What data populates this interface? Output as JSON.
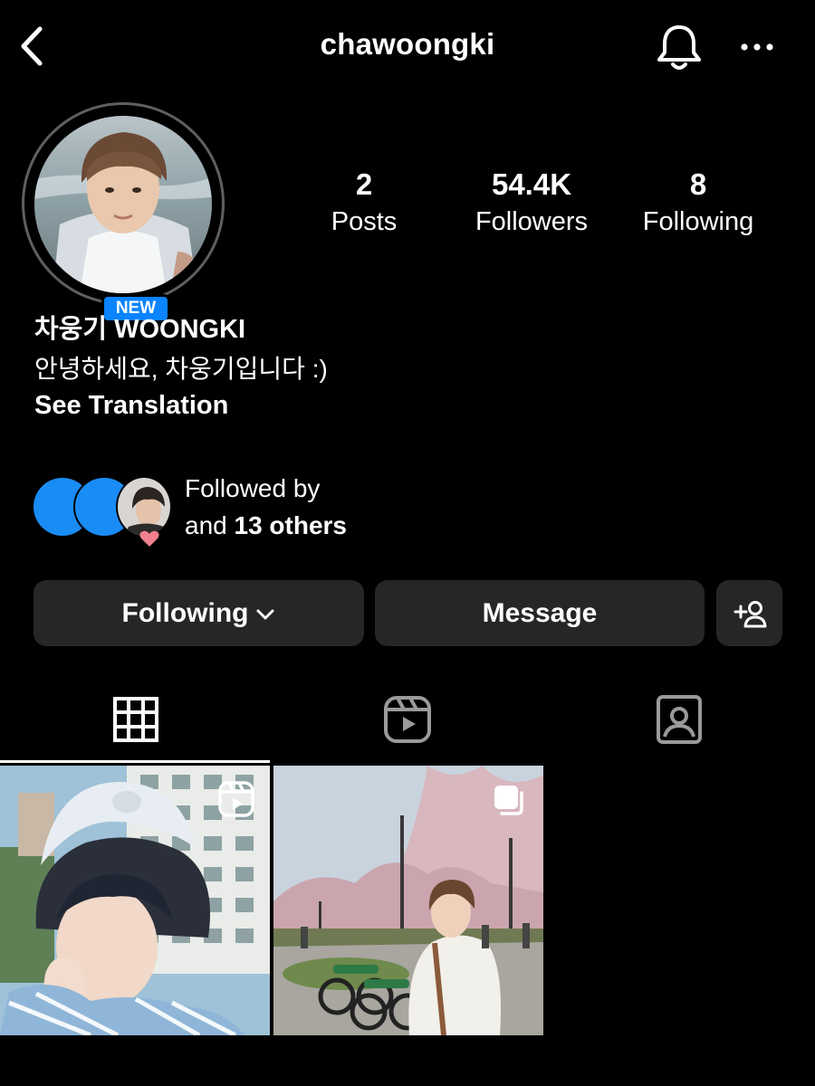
{
  "header": {
    "username": "chawoongki",
    "back_icon": "chevron-left-icon",
    "bell_icon": "bell-icon",
    "more_icon": "ellipsis-icon"
  },
  "profile": {
    "new_badge": "NEW",
    "display_name": "차웅기 WOONGKI",
    "bio": "안녕하세요, 차웅기입니다 :)",
    "see_translation": "See Translation"
  },
  "stats": {
    "posts": {
      "value": "2",
      "label": "Posts"
    },
    "followers": {
      "value": "54.4K",
      "label": "Followers"
    },
    "following": {
      "value": "8",
      "label": "Following"
    }
  },
  "followed_by": {
    "line1": "Followed by",
    "line2_prefix": "and ",
    "line2_bold": "13 others"
  },
  "actions": {
    "following_label": "Following",
    "message_label": "Message",
    "add_user_icon": "add-user-icon"
  },
  "tabs": [
    {
      "icon": "grid-icon",
      "active": true
    },
    {
      "icon": "reels-icon",
      "active": false
    },
    {
      "icon": "tagged-icon",
      "active": false
    }
  ],
  "posts": [
    {
      "overlay_icon": "reels-icon"
    },
    {
      "overlay_icon": "carousel-icon"
    }
  ],
  "colors": {
    "background": "#000000",
    "button_bg": "#262626",
    "accent_blue": "#0a84ff",
    "heart_pink": "#f07f8f"
  }
}
